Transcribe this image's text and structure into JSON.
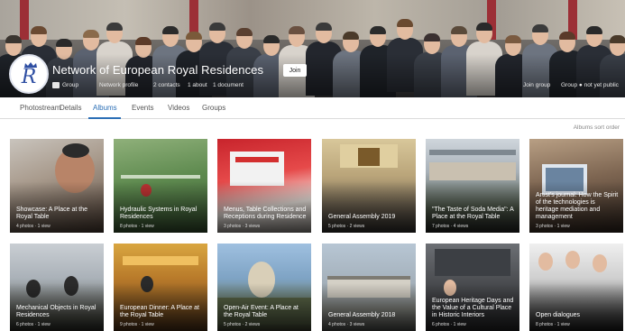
{
  "group": {
    "title": "Network of European Royal Residences",
    "follow_label": "Join",
    "meta": [
      "Group",
      "Network profile",
      "2 contacts",
      "1 about",
      "1 document"
    ],
    "right_meta": [
      "Join group",
      "Group ● not yet public"
    ],
    "brand_color": "#2f4fa3"
  },
  "tabs": {
    "items": [
      "Photostream",
      "Details",
      "Albums",
      "Events",
      "Videos",
      "Groups"
    ],
    "active": "Albums",
    "accent": "#2c6fb6"
  },
  "sort_link": "Albums sort order",
  "albums": [
    {
      "title": "Showcase: A Place at the Royal Table",
      "meta": "4 photos · 1 view"
    },
    {
      "title": "Hydraulic Systems in Royal Residences",
      "meta": "8 photos · 1 view"
    },
    {
      "title": "Menus, Table Collections and Receptions during Residence",
      "meta": "3 photos · 3 views"
    },
    {
      "title": "General Assembly 2019",
      "meta": "5 photos · 2 views"
    },
    {
      "title": "\"The Taste of Soda Media\": A Place at the Royal Table",
      "meta": "7 photos · 4 views"
    },
    {
      "title": "Artist's journal: How the Spirit of the technologies is heritage mediation and management",
      "meta": "3 photos · 1 view"
    },
    {
      "title": "Mechanical Objects in Royal Residences",
      "meta": "6 photos · 1 view"
    },
    {
      "title": "European Dinner: A Place at the Royal Table",
      "meta": "9 photos · 1 view"
    },
    {
      "title": "Open-Air Event: A Place at the Royal Table",
      "meta": "5 photos · 2 views"
    },
    {
      "title": "General Assembly 2018",
      "meta": "4 photos · 3 views"
    },
    {
      "title": "European Heritage Days and the Value of a Cultural Place in Historic Interiors",
      "meta": "6 photos · 1 view"
    },
    {
      "title": "Open dialogues",
      "meta": "8 photos · 1 view"
    }
  ]
}
